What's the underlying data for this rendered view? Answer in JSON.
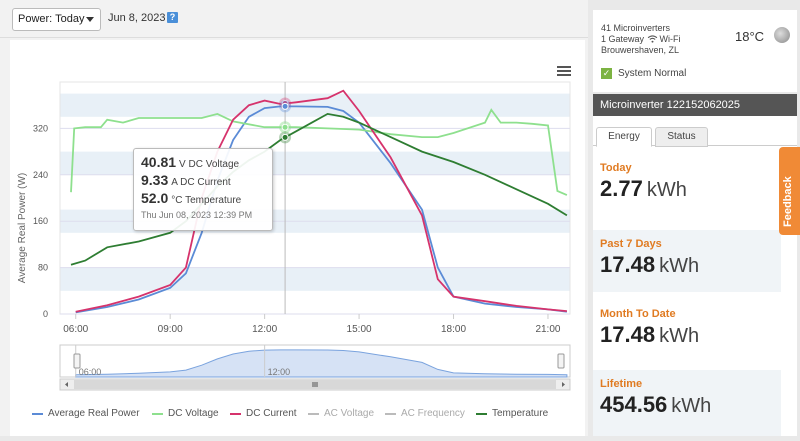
{
  "toolbar": {
    "period_select": "Power: Today",
    "date": "Jun 8, 2023",
    "help_glyph": "?"
  },
  "chart": {
    "ylabel": "Average Real Power (W)",
    "y_ticks": [
      "0",
      "80",
      "160",
      "240",
      "320"
    ],
    "x_ticks": [
      "06:00",
      "09:00",
      "12:00",
      "15:00",
      "18:00",
      "21:00"
    ],
    "navigator_ticks": [
      "06:00",
      "12:00"
    ],
    "tooltip": {
      "voltage_value": "40.81",
      "voltage_unit": "V DC Voltage",
      "current_value": "9.33",
      "current_unit": "A DC Current",
      "temp_value": "52.0",
      "temp_unit": "°C Temperature",
      "time": "Thu Jun 08, 2023 12:39 PM"
    },
    "legend": [
      "Average Real Power",
      "DC Voltage",
      "DC Current",
      "AC Voltage",
      "AC Frequency",
      "Temperature"
    ]
  },
  "chart_data": {
    "type": "line",
    "ylabel": "Average Real Power (W)",
    "ylim": [
      0,
      400
    ],
    "xlim": [
      5.5,
      21.7
    ],
    "x_ticks": [
      "06:00",
      "09:00",
      "12:00",
      "15:00",
      "18:00",
      "21:00"
    ],
    "grid": true,
    "legend_position": "bottom",
    "series": [
      {
        "name": "Average Real Power",
        "color": "#5b8bd6",
        "x": [
          6.0,
          7.0,
          8.0,
          9.0,
          9.5,
          10.0,
          10.5,
          11.0,
          11.5,
          12.0,
          12.5,
          13.0,
          14.0,
          14.5,
          15.0,
          16.0,
          17.0,
          17.5,
          18.0,
          19.0,
          20.0,
          21.0,
          21.6
        ],
        "y": [
          3,
          12,
          25,
          45,
          70,
          140,
          230,
          300,
          340,
          355,
          358,
          358,
          357,
          350,
          330,
          260,
          180,
          80,
          30,
          18,
          12,
          8,
          4
        ]
      },
      {
        "name": "DC Voltage",
        "color": "#8ee08e",
        "x": [
          5.85,
          5.95,
          6.3,
          6.8,
          7.0,
          7.5,
          8.0,
          9.0,
          10.0,
          10.5,
          11.0,
          12.0,
          13.0,
          14.0,
          15.0,
          16.0,
          17.0,
          17.5,
          18.0,
          19.0,
          19.2,
          19.5,
          20.0,
          20.5,
          21.0,
          21.3,
          21.6
        ],
        "y": [
          210,
          320,
          322,
          322,
          335,
          330,
          338,
          338,
          338,
          345,
          332,
          322,
          322,
          320,
          318,
          310,
          305,
          305,
          312,
          330,
          352,
          330,
          330,
          328,
          325,
          212,
          205
        ]
      },
      {
        "name": "DC Current",
        "color": "#d6336c",
        "x": [
          6.0,
          7.0,
          8.0,
          9.0,
          9.5,
          10.0,
          10.5,
          11.0,
          11.5,
          12.0,
          12.5,
          13.0,
          14.0,
          14.5,
          15.0,
          16.0,
          17.0,
          17.5,
          18.0,
          19.0,
          20.0,
          21.0,
          21.6
        ],
        "y": [
          4,
          15,
          30,
          50,
          80,
          200,
          280,
          335,
          360,
          368,
          362,
          365,
          372,
          385,
          350,
          270,
          170,
          60,
          30,
          22,
          14,
          8,
          5
        ]
      },
      {
        "name": "AC Voltage",
        "color": "#bbbbbb",
        "x": [],
        "y": []
      },
      {
        "name": "AC Frequency",
        "color": "#bbbbbb",
        "x": [],
        "y": []
      },
      {
        "name": "Temperature",
        "color": "#2e7d32",
        "x": [
          5.85,
          6.3,
          7.0,
          8.0,
          9.0,
          9.5,
          10.0,
          10.5,
          11.0,
          11.5,
          12.0,
          12.5,
          13.0,
          13.5,
          14.0,
          14.5,
          15.0,
          16.0,
          17.0,
          18.0,
          19.0,
          20.0,
          21.0,
          21.6
        ],
        "y": [
          85,
          92,
          115,
          125,
          140,
          160,
          190,
          220,
          245,
          265,
          280,
          300,
          315,
          330,
          345,
          340,
          330,
          305,
          280,
          262,
          240,
          215,
          190,
          170
        ]
      }
    ]
  },
  "device": {
    "summary_line1": "41 Microinverters",
    "summary_line2": "1 Gateway",
    "summary_wifi": "Wi-Fi",
    "summary_line3": "Brouwershaven, ZL",
    "temperature": "18°C",
    "status": "System Normal",
    "status_glyph": "✓",
    "title": "Microinverter 122152062025",
    "tabs": [
      "Energy",
      "Status"
    ],
    "stats": [
      {
        "label": "Today",
        "value": "2.77",
        "unit": "kWh"
      },
      {
        "label": "Past 7 Days",
        "value": "17.48",
        "unit": "kWh"
      },
      {
        "label": "Month To Date",
        "value": "17.48",
        "unit": "kWh"
      },
      {
        "label": "Lifetime",
        "value": "454.56",
        "unit": "kWh"
      }
    ],
    "feedback_label": "Feedback"
  },
  "colors": {
    "accent": "#e07b22",
    "feedback": "#f08a36",
    "header_dark": "#555555"
  }
}
